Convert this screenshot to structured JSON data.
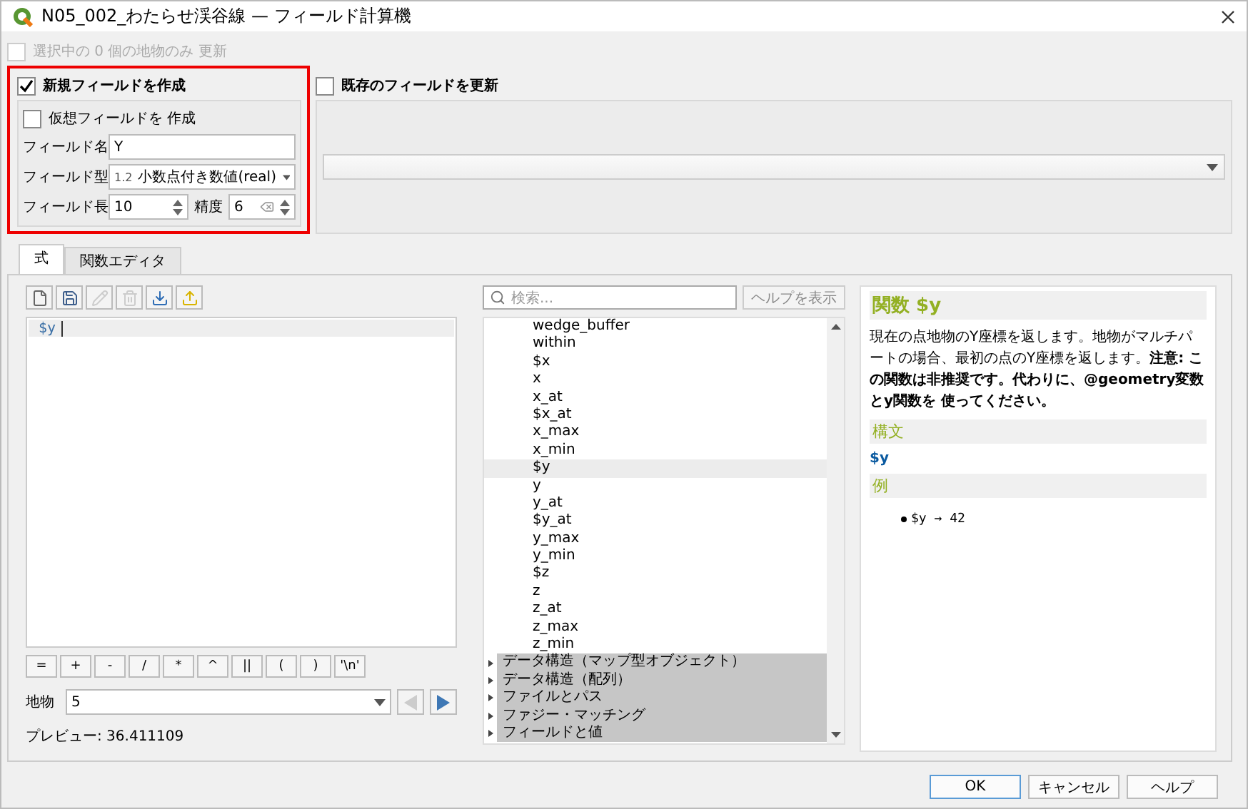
{
  "window": {
    "title": "N05_002_わたらせ渓谷線 — フィールド計算機"
  },
  "only_selected": {
    "label": "選択中の 0 個の地物のみ 更新",
    "checked": false,
    "disabled": true
  },
  "new_field": {
    "label": "新規フィールドを作成",
    "checked": true,
    "virtual": {
      "label": "仮想フィールドを 作成",
      "checked": false
    },
    "name_label": "フィールド名",
    "name_value": "Y",
    "type_label": "フィールド型",
    "type_prefix": "1.2",
    "type_value": "小数点付き数値(real)",
    "length_label": "フィールド長",
    "length_value": "10",
    "precision_label": "精度",
    "precision_value": "6"
  },
  "update_existing": {
    "label": "既存のフィールドを更新",
    "checked": false
  },
  "tabs": [
    {
      "label": "式",
      "selected": true
    },
    {
      "label": "関数エディタ",
      "selected": false
    }
  ],
  "expression": "$y",
  "operators": [
    "=",
    "+",
    "-",
    "/",
    "*",
    "^",
    "||",
    "(",
    ")",
    "'\\n'"
  ],
  "feature": {
    "label": "地物",
    "value": "5"
  },
  "preview": "プレビュー: 36.411109",
  "search": {
    "placeholder": "検索..."
  },
  "help_button": "ヘルプを表示",
  "functions": [
    {
      "label": "wedge_buffer",
      "selected": false
    },
    {
      "label": "within",
      "selected": false
    },
    {
      "label": "$x",
      "selected": false
    },
    {
      "label": "x",
      "selected": false
    },
    {
      "label": "x_at",
      "selected": false
    },
    {
      "label": "$x_at",
      "selected": false
    },
    {
      "label": "x_max",
      "selected": false
    },
    {
      "label": "x_min",
      "selected": false
    },
    {
      "label": "$y",
      "selected": true
    },
    {
      "label": "y",
      "selected": false
    },
    {
      "label": "y_at",
      "selected": false
    },
    {
      "label": "$y_at",
      "selected": false
    },
    {
      "label": "y_max",
      "selected": false
    },
    {
      "label": "y_min",
      "selected": false
    },
    {
      "label": "$z",
      "selected": false
    },
    {
      "label": "z",
      "selected": false
    },
    {
      "label": "z_at",
      "selected": false
    },
    {
      "label": "z_max",
      "selected": false
    },
    {
      "label": "z_min",
      "selected": false
    }
  ],
  "groups": [
    {
      "label": "データ構造（マップ型オブジェクト）",
      "expanded": false
    },
    {
      "label": "データ構造（配列）",
      "expanded": false
    },
    {
      "label": "ファイルとパス",
      "expanded": false
    },
    {
      "label": "ファジー・マッチング",
      "expanded": false
    },
    {
      "label": "フィールドと値",
      "expanded": false
    }
  ],
  "help": {
    "title": "関数 $y",
    "description": "現在の点地物のY座標を返します。地物がマルチパートの場合、最初の点のY座標を返します。**注意: この関数は非推奨です。代わりに、@geometry変数とy関数を 使ってください。**",
    "syntax_heading": "構文",
    "syntax": "$y",
    "example_heading": "例",
    "examples": [
      "$y → 42"
    ]
  },
  "buttons": [
    {
      "label": "OK",
      "kind": "default"
    },
    {
      "label": "キャンセル",
      "kind": "normal"
    },
    {
      "label": "ヘルプ",
      "kind": "normal"
    }
  ]
}
